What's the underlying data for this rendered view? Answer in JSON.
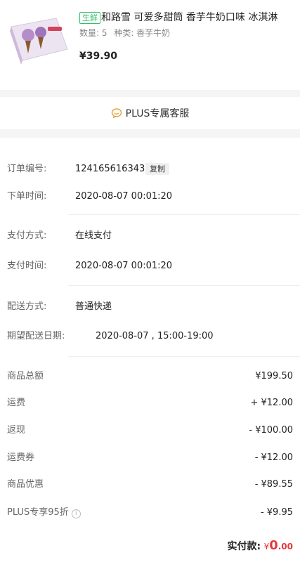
{
  "product": {
    "image_icon": "ice-cream-box-image",
    "tag": "生鲜",
    "title": "和路雪 可爱多甜筒 香芋牛奶口味 冰淇淋",
    "quantity": "数量: 5",
    "variant": "种类: 香芋牛奶",
    "price": "¥39.90"
  },
  "service": {
    "icon": "chat-bubble-icon",
    "label": "PLUS专属客服"
  },
  "order": {
    "number_label": "订单编号:",
    "number_value": "124165616343",
    "copy_label": "复制",
    "placed_label": "下单时间:",
    "placed_value": "2020-08-07 00:01:20",
    "pay_method_label": "支付方式:",
    "pay_method_value": "在线支付",
    "pay_time_label": "支付时间:",
    "pay_time_value": "2020-08-07 00:01:20",
    "ship_method_label": "配送方式:",
    "ship_method_value": "普通快递",
    "expected_label": "期望配送日期:",
    "expected_value": "2020-08-07 , 15:00-19:00"
  },
  "amounts": [
    {
      "label": "商品总额",
      "value": "¥199.50"
    },
    {
      "label": "运费",
      "value": "+ ¥12.00"
    },
    {
      "label": "返现",
      "value": "- ¥100.00"
    },
    {
      "label": "运费券",
      "value": "- ¥12.00"
    },
    {
      "label": "商品优惠",
      "value": "- ¥89.55"
    },
    {
      "label": "PLUS专享95折",
      "value": "- ¥9.95"
    }
  ],
  "paid": {
    "label": "实付款:",
    "symbol": "¥",
    "integer": "0",
    "decimal": ".00"
  },
  "colors": {
    "price_red": "#e4393c",
    "fresh_green": "#2fbf6a"
  }
}
